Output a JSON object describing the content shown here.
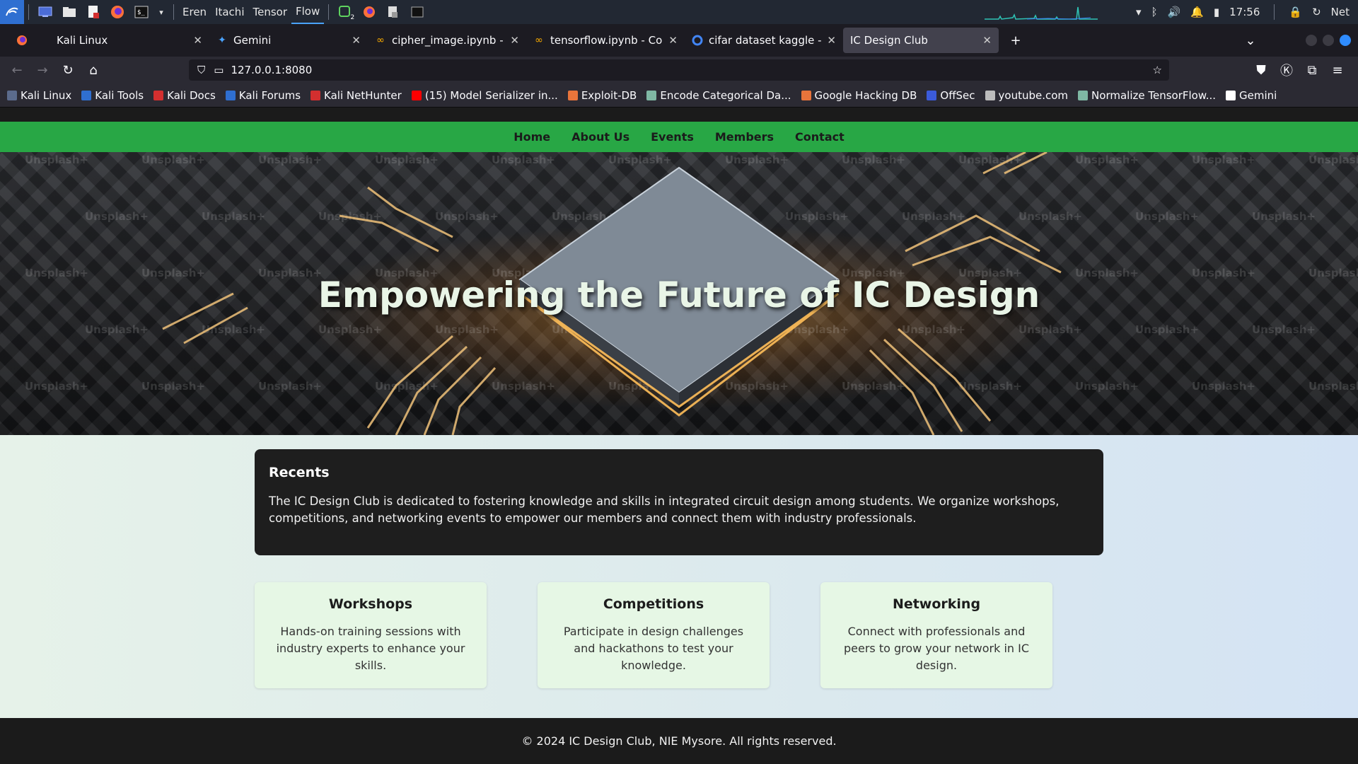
{
  "os_panel": {
    "workspaces": [
      "Eren",
      "Itachi",
      "Tensor",
      "Flow"
    ],
    "active_workspace": "Flow",
    "notification_count": "2",
    "clock": "17:56",
    "network_label": "Net",
    "accent": "#2f6fd1"
  },
  "browser": {
    "tabs": [
      {
        "title": "",
        "icon": "firefox-icon"
      },
      {
        "title": "Kali Linux",
        "icon": "none"
      },
      {
        "title": "Gemini",
        "icon": "gemini-icon"
      },
      {
        "title": "cipher_image.ipynb - Cola",
        "icon": "colab-icon"
      },
      {
        "title": "tensorflow.ipynb - Colab",
        "icon": "colab-icon"
      },
      {
        "title": "cifar dataset kaggle - Goo",
        "icon": "google-icon"
      },
      {
        "title": "IC Design Club",
        "icon": "none"
      }
    ],
    "active_tab": "IC Design Club",
    "url": "127.0.0.1:8080",
    "bookmarks": [
      {
        "label": "Kali Linux",
        "color": "#5b6b8c"
      },
      {
        "label": "Kali Tools",
        "color": "#2f6fd1"
      },
      {
        "label": "Kali Docs",
        "color": "#d32f2f"
      },
      {
        "label": "Kali Forums",
        "color": "#2f6fd1"
      },
      {
        "label": "Kali NetHunter",
        "color": "#d32f2f"
      },
      {
        "label": "(15) Model Serializer in...",
        "color": "#ff0000"
      },
      {
        "label": "Exploit-DB",
        "color": "#e8743b"
      },
      {
        "label": "Encode Categorical Da...",
        "color": "#7fb8a4"
      },
      {
        "label": "Google Hacking DB",
        "color": "#e8743b"
      },
      {
        "label": "OffSec",
        "color": "#3b5bdb"
      },
      {
        "label": "youtube.com",
        "color": "#bbbbbb"
      },
      {
        "label": "Normalize TensorFlow...",
        "color": "#7fb8a4"
      },
      {
        "label": "Gemini",
        "color": "#ffffff"
      }
    ]
  },
  "site": {
    "nav": [
      "Home",
      "About Us",
      "Events",
      "Members",
      "Contact"
    ],
    "hero_title": "Empowering the Future of IC Design",
    "watermark": "Unsplash+",
    "recents": {
      "title": "Recents",
      "text": "The IC Design Club is dedicated to fostering knowledge and skills in integrated circuit design among students. We organize workshops, competitions, and networking events to empower our members and connect them with industry professionals."
    },
    "cards": [
      {
        "title": "Workshops",
        "text": "Hands-on training sessions with industry experts to enhance your skills."
      },
      {
        "title": "Competitions",
        "text": "Participate in design challenges and hackathons to test your knowledge."
      },
      {
        "title": "Networking",
        "text": "Connect with professionals and peers to grow your network in IC design."
      }
    ],
    "footer": "© 2024 IC Design Club, NIE Mysore. All rights reserved.",
    "accent": "#28a745"
  }
}
